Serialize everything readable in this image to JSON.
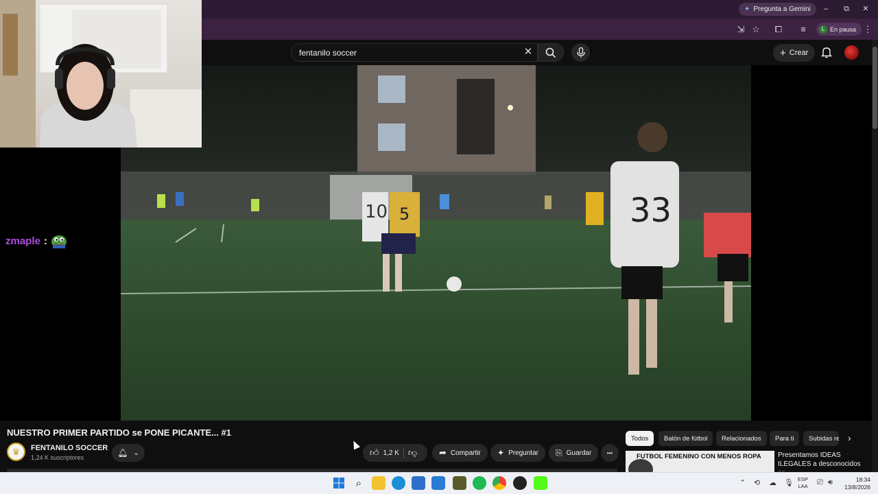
{
  "browser": {
    "gemini_label": "Pregunta a Gemini",
    "profile_initial": "L",
    "profile_status": "En pausa",
    "minimize": "–",
    "maximize": "⧉",
    "close": "✕"
  },
  "youtube": {
    "search_value": "fentanilo soccer",
    "create_label": "Crear",
    "video_title": "NUESTRO PRIMER PARTIDO se PONE PICANTE... #1",
    "channel_name": "FENTANILO SOCCER",
    "channel_subs": "1,24 K suscriptores",
    "like_count": "1,2 K",
    "share_label": "Compartir",
    "ask_label": "Preguntar",
    "save_label": "Guardar",
    "more_label": "•••",
    "chips": [
      "Todos",
      "Balón de fútbol",
      "Relacionados",
      "Para ti",
      "Subidas re"
    ],
    "rec_thumb_text": "FUTBOL FEMENINO CON MENOS ROPA",
    "rec_title": "Presentamos IDEAS ILEGALES a desconocidos en"
  },
  "stream": {
    "chat_user": "zmaple",
    "chat_sep": ":",
    "chat_color": "#b04ce0"
  },
  "jerseys": {
    "left_player": "10",
    "yellow_player": "5",
    "right_player": "33"
  },
  "taskbar": {
    "lang_line1": "ESP",
    "lang_line2": "LAA",
    "time": "18:34",
    "date": "13/8/2026"
  }
}
